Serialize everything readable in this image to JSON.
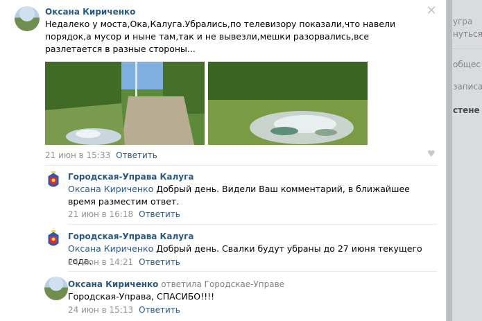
{
  "side": {
    "item1": "угра",
    "item2": "нуться",
    "item3": "общес",
    "item4": "записа",
    "item5": "стене"
  },
  "post": {
    "author": "Оксана Кириченко",
    "text": "Недалеко у моста,Ока,Калуга.Убрались,по телевизору показали,что навели порядок,а мусор и ныне там,так и не вывезли,мешки разорвались,все разлетается в разные стороны...",
    "date": "21 июн в 15:33",
    "reply_label": "Ответить",
    "close_icon": "close-icon",
    "like_icon": "heart-icon"
  },
  "comments": [
    {
      "author": "Городская-Управа Калуга",
      "mention": "Оксана Кириченко",
      "text": "Добрый день. Видели Ваш комментарий, в ближайшее время разместим ответ.",
      "date": "21 июн в 16:18",
      "reply_label": "Ответить"
    },
    {
      "author": "Городская-Управа Калуга",
      "mention": "Оксана Кириченко",
      "text": "Добрый день. Свалки будут убраны до 27 июня текущего года.",
      "date": "24 июн в 14:21",
      "reply_label": "Ответить"
    },
    {
      "author": "Оксана Кириченко",
      "replied_to": "ответила Городскае-Управе",
      "text": "Городская-Управа, СПАСИБО!!!!",
      "date": "24 июн в 15:13",
      "reply_label": "Ответить"
    }
  ],
  "colors": {
    "link": "#2a5885",
    "meta": "#939393",
    "background": "#ffffff"
  }
}
